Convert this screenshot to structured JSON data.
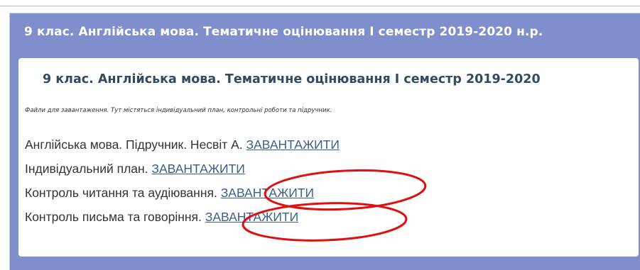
{
  "panel": {
    "title": "9 клас. Англійська мова. Тематичне оцінювання І семестр 2019-2020 н.р."
  },
  "card": {
    "title": "9 клас. Англійська мова. Тематичне оцінювання І семестр 2019-2020",
    "note": "Файли для завантаження. Тут містяться індивідуальний план, контрольні роботи та підручник.",
    "items": [
      {
        "label": "Англійська мова. Підручник. Несвіт А. ",
        "link": "ЗАВАНТАЖИТИ"
      },
      {
        "label": "Індивідуальний план. ",
        "link": "ЗАВАНТАЖИТИ"
      },
      {
        "label": "Контроль читання та аудіювання. ",
        "link": "ЗАВАНТАЖИТИ"
      },
      {
        "label": "Контроль письма та говоріння. ",
        "link": "ЗАВАНТАЖИТИ"
      }
    ]
  },
  "annotation_color": "#e01010"
}
